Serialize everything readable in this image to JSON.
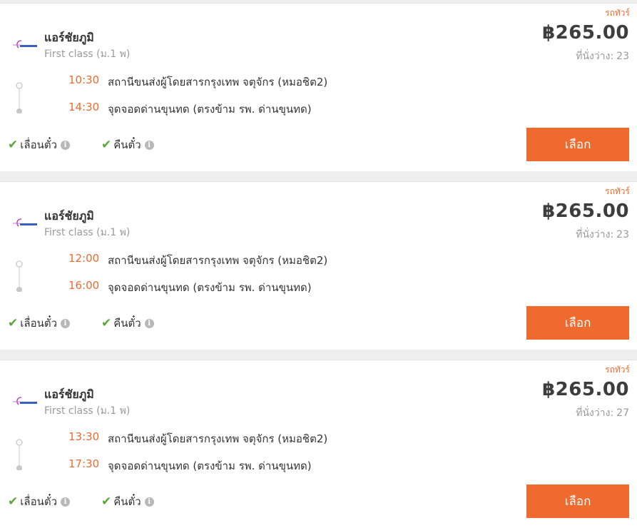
{
  "trips": [
    {
      "tag": "รถทัวร์",
      "operator": "แอร์ชัยภูมิ",
      "bus_class": "First class (ม.1 พ)",
      "price": "฿265.00",
      "seats_label": "ที่นั่งว่าง:",
      "seats_value": "23",
      "departure": {
        "time": "10:30",
        "place": "สถานีขนส่งผู้โดยสารกรุงเทพ จตุจักร (หมอชิต2)"
      },
      "arrival": {
        "time": "14:30",
        "place": "จุดจอดด่านขุนทด (ตรงข้าม รพ. ด่านขุนทด)"
      },
      "policy_change": "เลื่อนตั๋ว",
      "policy_refund": "คืนตั๋ว",
      "select_label": "เลือก"
    },
    {
      "tag": "รถทัวร์",
      "operator": "แอร์ชัยภูมิ",
      "bus_class": "First class (ม.1 พ)",
      "price": "฿265.00",
      "seats_label": "ที่นั่งว่าง:",
      "seats_value": "23",
      "departure": {
        "time": "12:00",
        "place": "สถานีขนส่งผู้โดยสารกรุงเทพ จตุจักร (หมอชิต2)"
      },
      "arrival": {
        "time": "16:00",
        "place": "จุดจอดด่านขุนทด (ตรงข้าม รพ. ด่านขุนทด)"
      },
      "policy_change": "เลื่อนตั๋ว",
      "policy_refund": "คืนตั๋ว",
      "select_label": "เลือก"
    },
    {
      "tag": "รถทัวร์",
      "operator": "แอร์ชัยภูมิ",
      "bus_class": "First class (ม.1 พ)",
      "price": "฿265.00",
      "seats_label": "ที่นั่งว่าง:",
      "seats_value": "27",
      "departure": {
        "time": "13:30",
        "place": "สถานีขนส่งผู้โดยสารกรุงเทพ จตุจักร (หมอชิต2)"
      },
      "arrival": {
        "time": "17:30",
        "place": "จุดจอดด่านขุนทด (ตรงข้าม รพ. ด่านขุนทด)"
      },
      "policy_change": "เลื่อนตั๋ว",
      "policy_refund": "คืนตั๋ว",
      "select_label": "เลือก"
    }
  ],
  "icons": {
    "check": "check-icon",
    "info": "info-icon",
    "logo": "operator-logo"
  },
  "colors": {
    "accent": "#ee6a2e",
    "check": "#5aa63c",
    "text": "#333333",
    "muted": "#9a9a9a"
  }
}
